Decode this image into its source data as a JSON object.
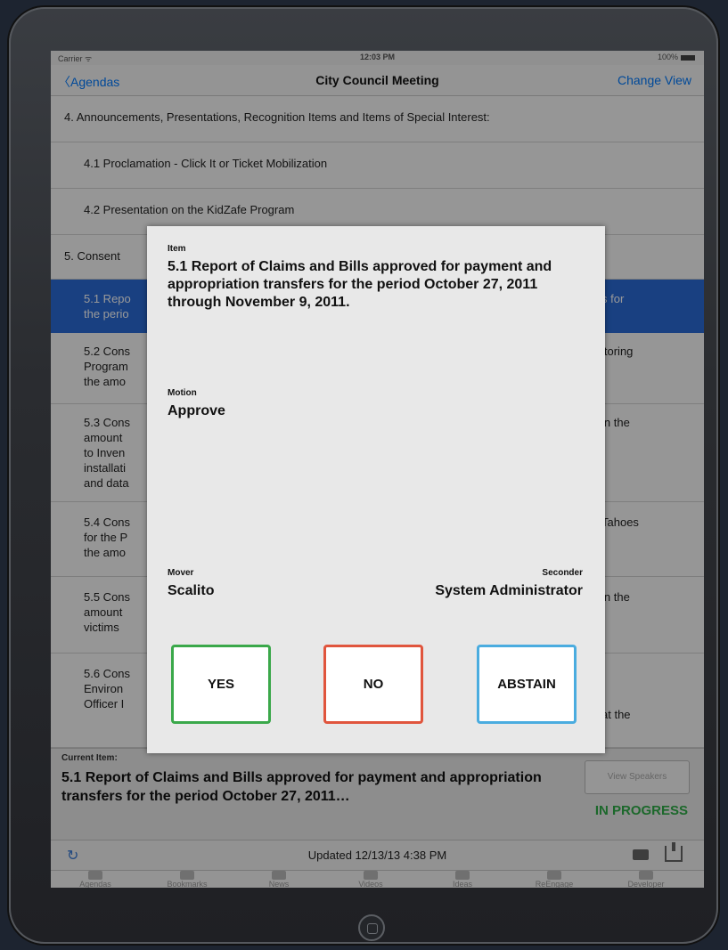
{
  "status_bar": {
    "carrier": "Carrier ᯤ",
    "time": "12:03 PM",
    "battery": "100%"
  },
  "nav": {
    "back_label": "Agendas",
    "title": "City Council Meeting",
    "right_label": "Change View"
  },
  "agenda_items": [
    {
      "text": "4. Announcements, Presentations, Recognition Items and Items of Special Interest:"
    },
    {
      "text": "4.1 Proclamation - Click It or Ticket Mobilization"
    },
    {
      "text": "4.2 Presentation on the KidZafe Program"
    },
    {
      "text": "5. Consent"
    },
    {
      "text": "5.1 Repo",
      "text2": "the perio",
      "right": "s for"
    },
    {
      "text": "5.2 Cons",
      "text2": "Program",
      "text3": "the amo",
      "right": "itoring"
    },
    {
      "text": "5.3 Cons",
      "text2": "amount",
      "text3": "to Inven",
      "text4": "installati",
      "text5": "and data",
      "right": "in the"
    },
    {
      "text": "5.4 Cons",
      "text2": "for the P",
      "text3": "the amo",
      "right": "Tahoes"
    },
    {
      "text": "5.5 Cons",
      "text2": "amount",
      "text3": "victims",
      "right": "in the"
    },
    {
      "text": "5.6 Cons",
      "text2": "Environ",
      "text3": "Officer I",
      "right": "at the"
    }
  ],
  "current_item": {
    "label": "Current Item:",
    "text": "5.1 Report of Claims and Bills approved for payment and appropriation transfers for the period October 27, 2011…",
    "speakers_button": "View Speakers",
    "status": "IN PROGRESS",
    "status_color": "#2fae48"
  },
  "updated_bar": {
    "text": "Updated 12/13/13 4:38 PM"
  },
  "tabs": [
    "Agendas",
    "Bookmarks",
    "News",
    "Videos",
    "Ideas",
    "ReEngage",
    "Developer"
  ],
  "modal": {
    "item_label": "Item",
    "item_text": "5.1 Report of Claims and Bills approved for payment and appropriation transfers for the period October 27, 2011 through November 9, 2011.",
    "motion_label": "Motion",
    "motion_value": "Approve",
    "mover_label": "Mover",
    "mover_value": "Scalito",
    "seconder_label": "Seconder",
    "seconder_value": "System Administrator",
    "votes": [
      {
        "label": "YES",
        "color": "#3aa84a"
      },
      {
        "label": "NO",
        "color": "#e0553d"
      },
      {
        "label": "ABSTAIN",
        "color": "#4aacdf"
      }
    ]
  },
  "colors": {
    "selected_row": "#2a6bd8",
    "accent": "#007aff"
  }
}
